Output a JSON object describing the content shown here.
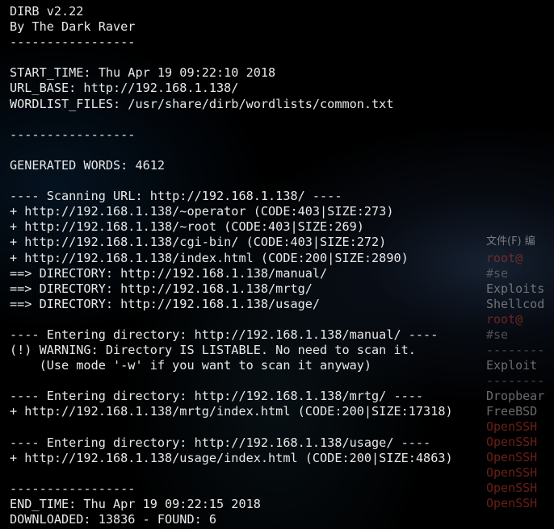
{
  "terminal": {
    "lines": [
      "DIRB v2.22",
      "By The Dark Raver",
      "-----------------",
      "",
      "START_TIME: Thu Apr 19 09:22:10 2018",
      "URL_BASE: http://192.168.1.138/",
      "WORDLIST_FILES: /usr/share/dirb/wordlists/common.txt",
      "",
      "-----------------",
      "",
      "GENERATED WORDS: 4612",
      "",
      "---- Scanning URL: http://192.168.1.138/ ----",
      "+ http://192.168.1.138/~operator (CODE:403|SIZE:273)",
      "+ http://192.168.1.138/~root (CODE:403|SIZE:269)",
      "+ http://192.168.1.138/cgi-bin/ (CODE:403|SIZE:272)",
      "+ http://192.168.1.138/index.html (CODE:200|SIZE:2890)",
      "==> DIRECTORY: http://192.168.1.138/manual/",
      "==> DIRECTORY: http://192.168.1.138/mrtg/",
      "==> DIRECTORY: http://192.168.1.138/usage/",
      "",
      "---- Entering directory: http://192.168.1.138/manual/ ----",
      "(!) WARNING: Directory IS LISTABLE. No need to scan it.",
      "    (Use mode '-w' if you want to scan it anyway)",
      "",
      "---- Entering directory: http://192.168.1.138/mrtg/ ----",
      "+ http://192.168.1.138/mrtg/index.html (CODE:200|SIZE:17318)",
      "",
      "---- Entering directory: http://192.168.1.138/usage/ ----",
      "+ http://192.168.1.138/usage/index.html (CODE:200|SIZE:4863)",
      "",
      "-----------------",
      "END_TIME: Thu Apr 19 09:22:15 2018",
      "DOWNLOADED: 13836 - FOUND: 6"
    ]
  },
  "background_window": {
    "menu": "文件(F) 编",
    "lines": [
      {
        "text": "root@",
        "style": "red"
      },
      {
        "text": "#se",
        "style": "dim"
      },
      {
        "text": "Exploits",
        "style": "normal"
      },
      {
        "text": "Shellcod",
        "style": "normal"
      },
      {
        "text": "root@",
        "style": "red"
      },
      {
        "text": "#se",
        "style": "dim"
      },
      {
        "text": "--------",
        "style": "dim"
      },
      {
        "text": " Exploit",
        "style": "normal"
      },
      {
        "text": "--------",
        "style": "dim"
      },
      {
        "text": "Dropbear",
        "style": "normal"
      },
      {
        "text": "FreeBSD",
        "style": "normal"
      },
      {
        "text": "OpenSSH",
        "style": "red"
      },
      {
        "text": "OpenSSH",
        "style": "red"
      },
      {
        "text": "OpenSSH",
        "style": "red"
      },
      {
        "text": "OpenSSH",
        "style": "red"
      },
      {
        "text": "OpenSSH",
        "style": "red"
      },
      {
        "text": "OpenSSH",
        "style": "red"
      }
    ]
  },
  "colors": {
    "text": "#e8e8e8",
    "background": "#000000",
    "highlight_red": "#c0392b"
  }
}
